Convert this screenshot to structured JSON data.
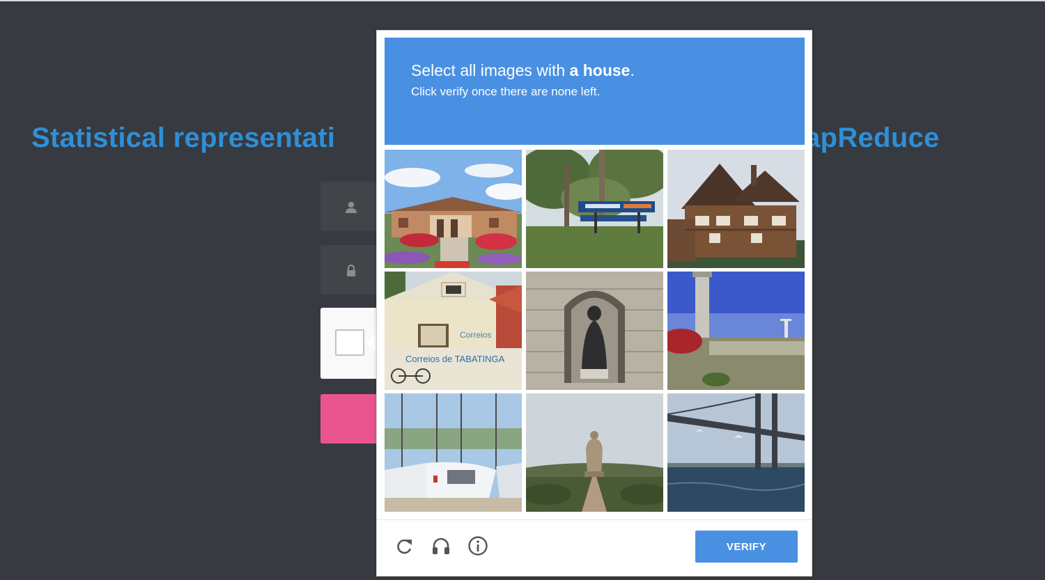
{
  "page": {
    "title_left": "Statistical representati",
    "title_right": "apReduce"
  },
  "challenge": {
    "prompt_prefix": "Select all images with ",
    "prompt_target": "a house",
    "prompt_suffix": ".",
    "instruction": "Click verify once there are none left.",
    "verify_label": "VERIFY",
    "tiles": [
      {
        "subject": "house with garden"
      },
      {
        "subject": "trees with sign"
      },
      {
        "subject": "wooden chalet"
      },
      {
        "subject": "Correios building"
      },
      {
        "subject": "stone statue niche"
      },
      {
        "subject": "lighthouse tower"
      },
      {
        "subject": "sailboats in harbor"
      },
      {
        "subject": "giant statue on hill"
      },
      {
        "subject": "bridge over water"
      }
    ],
    "tile_sign_text": "Correios de TABATINGA",
    "tile_sign_small": "Correios"
  },
  "colors": {
    "background": "#373a40",
    "title": "#2f8fd6",
    "header": "#4a90e2",
    "login_button": "#e9548f"
  },
  "icons": [
    "user-icon",
    "lock-icon",
    "reload-icon",
    "headphones-icon",
    "info-icon"
  ]
}
